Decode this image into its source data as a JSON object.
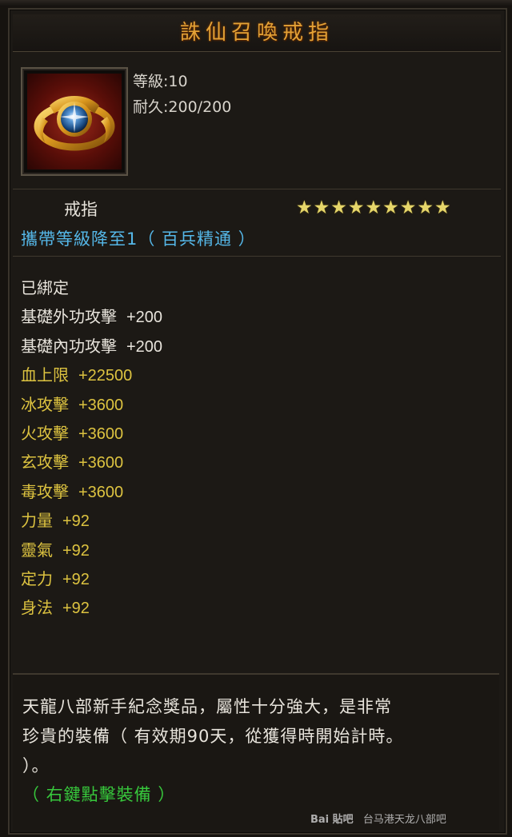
{
  "item": {
    "name": "誅仙召喚戒指",
    "level_label": "等級:10",
    "durability_label": "耐久:200/200",
    "type": "戒指",
    "star_count": 9,
    "carry_text": "攜帶等級降至1（ 百兵精通 ）"
  },
  "stats": [
    {
      "name": "已綁定",
      "value": "",
      "color": "white"
    },
    {
      "name": "基礎外功攻擊",
      "value": "+200",
      "color": "white"
    },
    {
      "name": "基礎內功攻擊",
      "value": "+200",
      "color": "white"
    },
    {
      "name": "血上限",
      "value": "+22500",
      "color": "gold"
    },
    {
      "name": "冰攻擊",
      "value": "+3600",
      "color": "gold"
    },
    {
      "name": "火攻擊",
      "value": "+3600",
      "color": "gold"
    },
    {
      "name": "玄攻擊",
      "value": "+3600",
      "color": "gold"
    },
    {
      "name": "毒攻擊",
      "value": "+3600",
      "color": "gold"
    },
    {
      "name": "力量",
      "value": "+92",
      "color": "gold"
    },
    {
      "name": "靈氣",
      "value": "+92",
      "color": "gold"
    },
    {
      "name": "定力",
      "value": "+92",
      "color": "gold"
    },
    {
      "name": "身法",
      "value": "+92",
      "color": "gold"
    }
  ],
  "description": {
    "lines": [
      "天龍八部新手紀念獎品，屬性十分強大，是非常",
      "珍貴的裝備（ 有效期90天，從獲得時開始計時。",
      "）。"
    ],
    "action": "（ 右鍵點擊裝備 ）"
  },
  "watermark": {
    "brand": "Bai 貼吧",
    "text": "台马港天龙八部吧"
  },
  "colors": {
    "title": "#e4a236",
    "attribute": "#ddc340",
    "carry": "#55b7e8",
    "action": "#37c83c"
  },
  "icons": {
    "item": "ring-icon",
    "star": "star-icon"
  }
}
